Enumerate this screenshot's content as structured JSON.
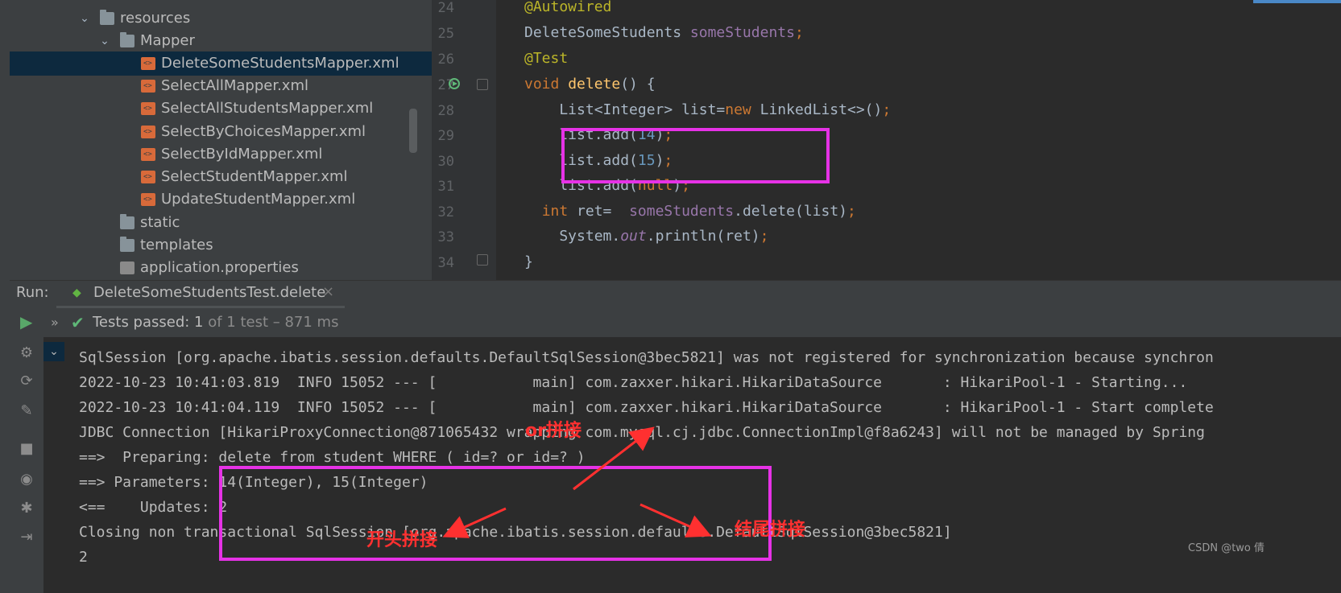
{
  "project_tree": {
    "items": [
      {
        "label": "resources",
        "kind": "folder",
        "expanded": true
      },
      {
        "label": "Mapper",
        "kind": "folder",
        "expanded": true
      },
      {
        "label": "DeleteSomeStudentsMapper.xml",
        "kind": "xml",
        "selected": true
      },
      {
        "label": "SelectAllMapper.xml",
        "kind": "xml"
      },
      {
        "label": "SelectAllStudentsMapper.xml",
        "kind": "xml"
      },
      {
        "label": "SelectByChoicesMapper.xml",
        "kind": "xml"
      },
      {
        "label": "SelectByIdMapper.xml",
        "kind": "xml"
      },
      {
        "label": "SelectStudentMapper.xml",
        "kind": "xml"
      },
      {
        "label": "UpdateStudentMapper.xml",
        "kind": "xml"
      },
      {
        "label": "static",
        "kind": "folder"
      },
      {
        "label": "templates",
        "kind": "folder"
      },
      {
        "label": "application.properties",
        "kind": "properties"
      }
    ]
  },
  "editor": {
    "lines": [
      {
        "num": "24",
        "parts": [
          [
            "ann",
            "@Autowired"
          ]
        ]
      },
      {
        "num": "25",
        "parts": [
          [
            "plain",
            "DeleteSomeStudents "
          ],
          [
            "fld",
            "someStudents"
          ],
          [
            "kw",
            ";"
          ]
        ]
      },
      {
        "num": "26",
        "parts": [
          [
            "ann",
            "@Test"
          ]
        ]
      },
      {
        "num": "27",
        "parts": [
          [
            "kw",
            "void "
          ],
          [
            "fn",
            "delete"
          ],
          [
            "plain",
            "() {"
          ]
        ]
      },
      {
        "num": "28",
        "parts": [
          [
            "plain",
            "    List<Integer> list="
          ],
          [
            "kw",
            "new "
          ],
          [
            "plain",
            "LinkedList<>()"
          ],
          [
            "kw",
            ";"
          ]
        ]
      },
      {
        "num": "29",
        "parts": [
          [
            "plain",
            "    list.add("
          ],
          [
            "num",
            "14"
          ],
          [
            "plain",
            ")"
          ],
          [
            "kw",
            ";"
          ]
        ]
      },
      {
        "num": "30",
        "parts": [
          [
            "plain",
            "    list.add("
          ],
          [
            "num",
            "15"
          ],
          [
            "plain",
            ")"
          ],
          [
            "kw",
            ";"
          ]
        ]
      },
      {
        "num": "31",
        "parts": [
          [
            "plain",
            "    list.add("
          ],
          [
            "kw",
            "null"
          ],
          [
            "plain",
            ")"
          ],
          [
            "kw",
            ";"
          ]
        ]
      },
      {
        "num": "32",
        "parts": [
          [
            "plain",
            "  "
          ],
          [
            "kw",
            "int "
          ],
          [
            "plain",
            "ret=  "
          ],
          [
            "fld",
            "someStudents"
          ],
          [
            "plain",
            ".delete(list)"
          ],
          [
            "kw",
            ";"
          ]
        ]
      },
      {
        "num": "33",
        "parts": [
          [
            "plain",
            "    System."
          ],
          [
            "static",
            "out"
          ],
          [
            "plain",
            ".println(ret)"
          ],
          [
            "kw",
            ";"
          ]
        ]
      },
      {
        "num": "34",
        "parts": [
          [
            "plain",
            "}"
          ]
        ]
      }
    ]
  },
  "run_window": {
    "label": "Run:",
    "tab_label": "DeleteSomeStudentsTest.delete",
    "close_glyph": "×",
    "status_bold": "Tests passed: 1",
    "status_dim": " of 1 test – 871 ms"
  },
  "console": {
    "lines": [
      "SqlSession [org.apache.ibatis.session.defaults.DefaultSqlSession@3bec5821] was not registered for synchronization because synchron",
      "2022-10-23 10:41:03.819  INFO 15052 --- [           main] com.zaxxer.hikari.HikariDataSource       : HikariPool-1 - Starting...",
      "2022-10-23 10:41:04.119  INFO 15052 --- [           main] com.zaxxer.hikari.HikariDataSource       : HikariPool-1 - Start complete",
      "JDBC Connection [HikariProxyConnection@871065432 wrapping com.mysql.cj.jdbc.ConnectionImpl@f8a6243] will not be managed by Spring",
      "==>  Preparing: delete from student WHERE ( id=? or id=? )",
      "==> Parameters: 14(Integer), 15(Integer)",
      "<==    Updates: 2",
      "Closing non transactional SqlSession [org.apache.ibatis.session.defaults.DefaultSqlSession@3bec5821]",
      "2"
    ]
  },
  "annotations": {
    "or_label": "or拼接",
    "start_label": "开头拼接",
    "end_label": "结尾拼接"
  },
  "watermark": "CSDN @two 倩",
  "colors": {
    "highlight_box": "#e632e6",
    "annotation_text": "#ff3030",
    "keyword": "#cc7832",
    "annotation": "#bbb529",
    "field": "#9876aa",
    "function": "#ffc66d",
    "number": "#6897bb"
  }
}
